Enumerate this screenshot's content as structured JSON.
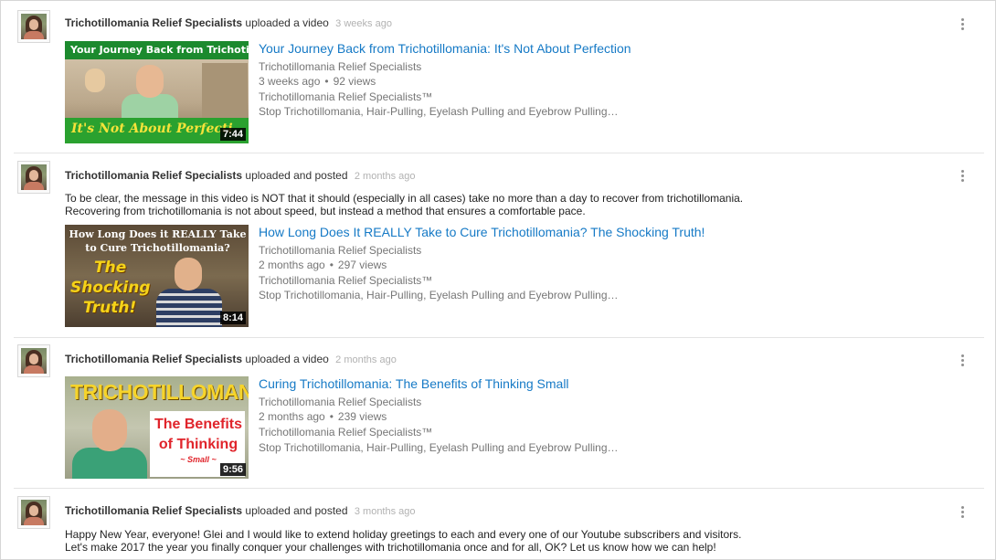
{
  "feed": [
    {
      "channel": "Trichotillomania Relief Specialists",
      "action": "uploaded a video",
      "time": "3 weeks ago",
      "video": {
        "title": "Your Journey Back from Trichotillomania: It's Not About Perfection",
        "channel": "Trichotillomania Relief Specialists",
        "age": "3 weeks ago",
        "views": "92 views",
        "owner": "Trichotillomania Relief Specialists™",
        "description": "Stop Trichotillomania, Hair-Pulling, Eyelash Pulling and Eyebrow Pulling…",
        "duration": "7:44",
        "thumb_top": "Your Journey Back from Trichotillomania",
        "thumb_bottom": "It's Not About Perfecti"
      }
    },
    {
      "channel": "Trichotillomania Relief Specialists",
      "action": "uploaded and posted",
      "time": "2 months ago",
      "post_lines": [
        "To be clear, the message in this video is NOT that it should (especially in all cases) take no more than a day to recover from trichotillomania.",
        "Recovering from trichotillomania is not about speed, but instead a method that ensures a comfortable pace."
      ],
      "video": {
        "title": "How Long Does It REALLY Take to Cure Trichotillomania? The Shocking Truth!",
        "channel": "Trichotillomania Relief Specialists",
        "age": "2 months ago",
        "views": "297 views",
        "owner": "Trichotillomania Relief Specialists™",
        "description": "Stop Trichotillomania, Hair-Pulling, Eyelash Pulling and Eyebrow Pulling…",
        "duration": "8:14",
        "thumb_top_1": "How Long Does it REALLY Take",
        "thumb_top_2": "to Cure Trichotillomania?",
        "thumb_shock_1": "The",
        "thumb_shock_2": "Shocking",
        "thumb_shock_3": "Truth!"
      }
    },
    {
      "channel": "Trichotillomania Relief Specialists",
      "action": "uploaded a video",
      "time": "2 months ago",
      "video": {
        "title": "Curing Trichotillomania: The Benefits of Thinking Small",
        "channel": "Trichotillomania Relief Specialists",
        "age": "2 months ago",
        "views": "239 views",
        "owner": "Trichotillomania Relief Specialists™",
        "description": "Stop Trichotillomania, Hair-Pulling, Eyelash Pulling and Eyebrow Pulling…",
        "duration": "9:56",
        "thumb_top": "TRICHOTILLOMANIA",
        "thumb_benefits_1": "The Benefits",
        "thumb_benefits_2": "of Thinking",
        "thumb_small": "~ Small ~"
      }
    },
    {
      "channel": "Trichotillomania Relief Specialists",
      "action": "uploaded and posted",
      "time": "3 months ago",
      "post_lines": [
        "Happy New Year, everyone! Glei and I would like to extend holiday greetings to each and every one of our Youtube subscribers and visitors.",
        "Let's make 2017 the year you finally conquer your challenges with trichotillomania once and for all, OK? Let us know how we can help!"
      ]
    }
  ],
  "icons": {
    "avatar": "channel-avatar",
    "menu": "vertical-dots-menu-icon"
  },
  "colors": {
    "link": "#167ac6",
    "meta": "#767676",
    "time": "#b2b2b2"
  }
}
